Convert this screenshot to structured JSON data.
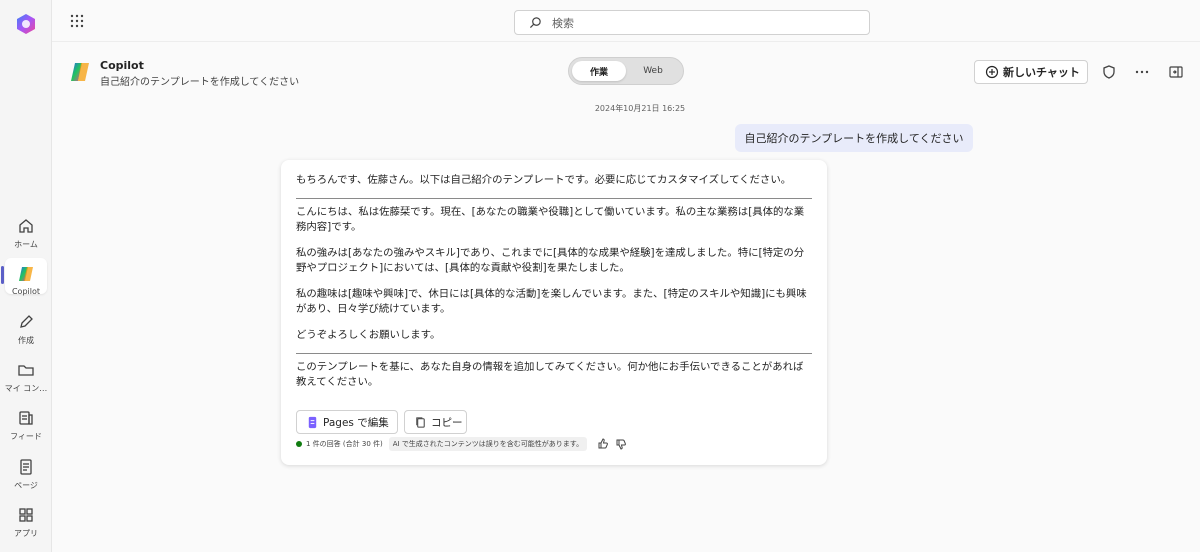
{
  "rail": {
    "items": [
      {
        "label": "ホーム",
        "icon": "home-icon"
      },
      {
        "label": "Copilot",
        "icon": "copilot-icon"
      },
      {
        "label": "作成",
        "icon": "pen-icon"
      },
      {
        "label": "マイ コン…",
        "icon": "folder-icon"
      },
      {
        "label": "フィード",
        "icon": "feed-icon"
      },
      {
        "label": "ページ",
        "icon": "page-icon"
      },
      {
        "label": "アプリ",
        "icon": "apps-icon"
      }
    ]
  },
  "topbar": {
    "search_placeholder": "検索"
  },
  "header": {
    "title": "Copilot",
    "subtitle": "自己紹介のテンプレートを作成してください",
    "toggle": {
      "work": "作業",
      "web": "Web",
      "selected": "作業"
    },
    "new_chat_label": "新しいチャット"
  },
  "chat": {
    "timestamp": "2024年10月21日 16:25",
    "user_message": "自己紹介のテンプレートを作成してください",
    "reply": {
      "intro": "もちろんです、佐藤さん。以下は自己紹介のテンプレートです。必要に応じてカスタマイズしてください。",
      "p1": "こんにちは、私は佐藤栞です。現在、[あなたの職業や役職]として働いています。私の主な業務は[具体的な業務内容]です。",
      "p2": "私の強みは[あなたの強みやスキル]であり、これまでに[具体的な成果や経験]を達成しました。特に[特定の分野やプロジェクト]においては、[具体的な貢献や役割]を果たしました。",
      "p3": "私の趣味は[趣味や興味]で、休日には[具体的な活動]を楽しんでいます。また、[特定のスキルや知識]にも興味があり、日々学び続けています。",
      "p4": "どうぞよろしくお願いします。",
      "outro": "このテンプレートを基に、あなた自身の情報を追加してみてください。何か他にお手伝いできることがあれば教えてください。",
      "pages_button": "Pages で編集",
      "copy_button": "コピー",
      "response_count": "1 件の回答 (合計 30 件)",
      "disclaimer": "AI で生成されたコンテンツは誤りを含む可能性があります。"
    }
  },
  "colors": {
    "accent": "#5b5fc7",
    "user_bubble": "#e8ebfa",
    "status_green": "#107c10"
  }
}
